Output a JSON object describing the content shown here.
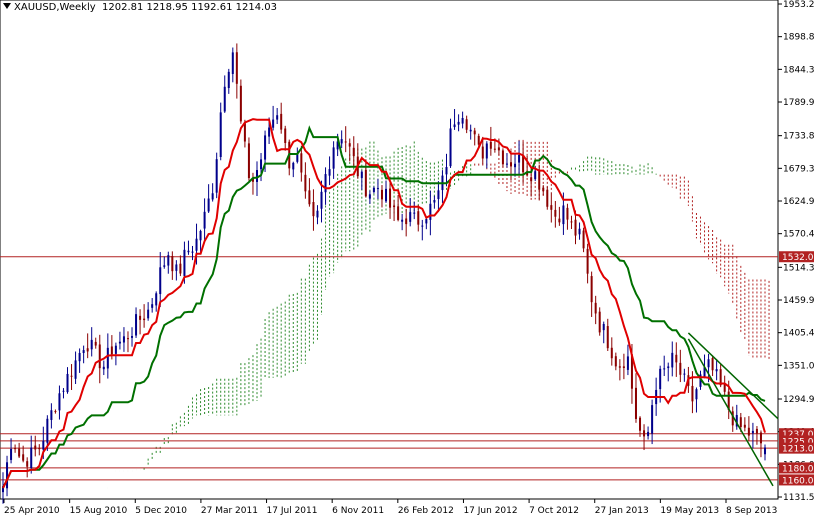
{
  "header": {
    "symbol": "XAUUSD,Weekly",
    "ohlc": "1202.81 1218.95 1192.61 1214.03"
  },
  "chart_data": {
    "type": "candlestick",
    "instrument": "XAUUSD",
    "timeframe": "Weekly",
    "ylim": [
      1131.55,
      1953.25
    ],
    "y_ticks": [
      1953.25,
      1898.8,
      1844.35,
      1789.9,
      1733.8,
      1679.35,
      1624.9,
      1570.45,
      1514.35,
      1459.9,
      1405.45,
      1351.0,
      1294.9,
      1240.45,
      1186.0,
      1131.55
    ],
    "x_ticks": [
      "25 Apr 2010",
      "15 Aug 2010",
      "5 Dec 2010",
      "27 Mar 2011",
      "17 Jul 2011",
      "6 Nov 2011",
      "26 Feb 2012",
      "17 Jun 2012",
      "7 Oct 2012",
      "27 Jan 2013",
      "19 May 2013",
      "8 Sep 2013"
    ],
    "horizontal_levels": [
      1532.0,
      1237.0,
      1225.0,
      1213.0,
      1180.0,
      1160.0
    ],
    "colors": {
      "bull_candle": "#00008b",
      "bear_candle": "#8b0000",
      "tenkan": "#e00000",
      "kijun": "#007000",
      "cloud_bull": "#2e8b2e",
      "cloud_bear": "#b22222",
      "level_line": "#b22222",
      "trend_line": "#006400"
    },
    "price_path": [
      1150,
      1235,
      1190,
      1200,
      1215,
      1260,
      1300,
      1330,
      1360,
      1395,
      1370,
      1350,
      1385,
      1390,
      1410,
      1430,
      1445,
      1500,
      1540,
      1500,
      1540,
      1555,
      1600,
      1660,
      1820,
      1880,
      1740,
      1650,
      1690,
      1750,
      1780,
      1690,
      1700,
      1620,
      1580,
      1660,
      1720,
      1740,
      1700,
      1660,
      1640,
      1650,
      1620,
      1590,
      1600,
      1590,
      1605,
      1620,
      1660,
      1760,
      1780,
      1740,
      1700,
      1730,
      1710,
      1690,
      1695,
      1680,
      1670,
      1640,
      1600,
      1610,
      1580,
      1560,
      1470,
      1420,
      1390,
      1350,
      1370,
      1260,
      1210,
      1320,
      1340,
      1360,
      1330,
      1290,
      1330,
      1350,
      1320,
      1280,
      1250,
      1240,
      1230,
      1214
    ]
  }
}
